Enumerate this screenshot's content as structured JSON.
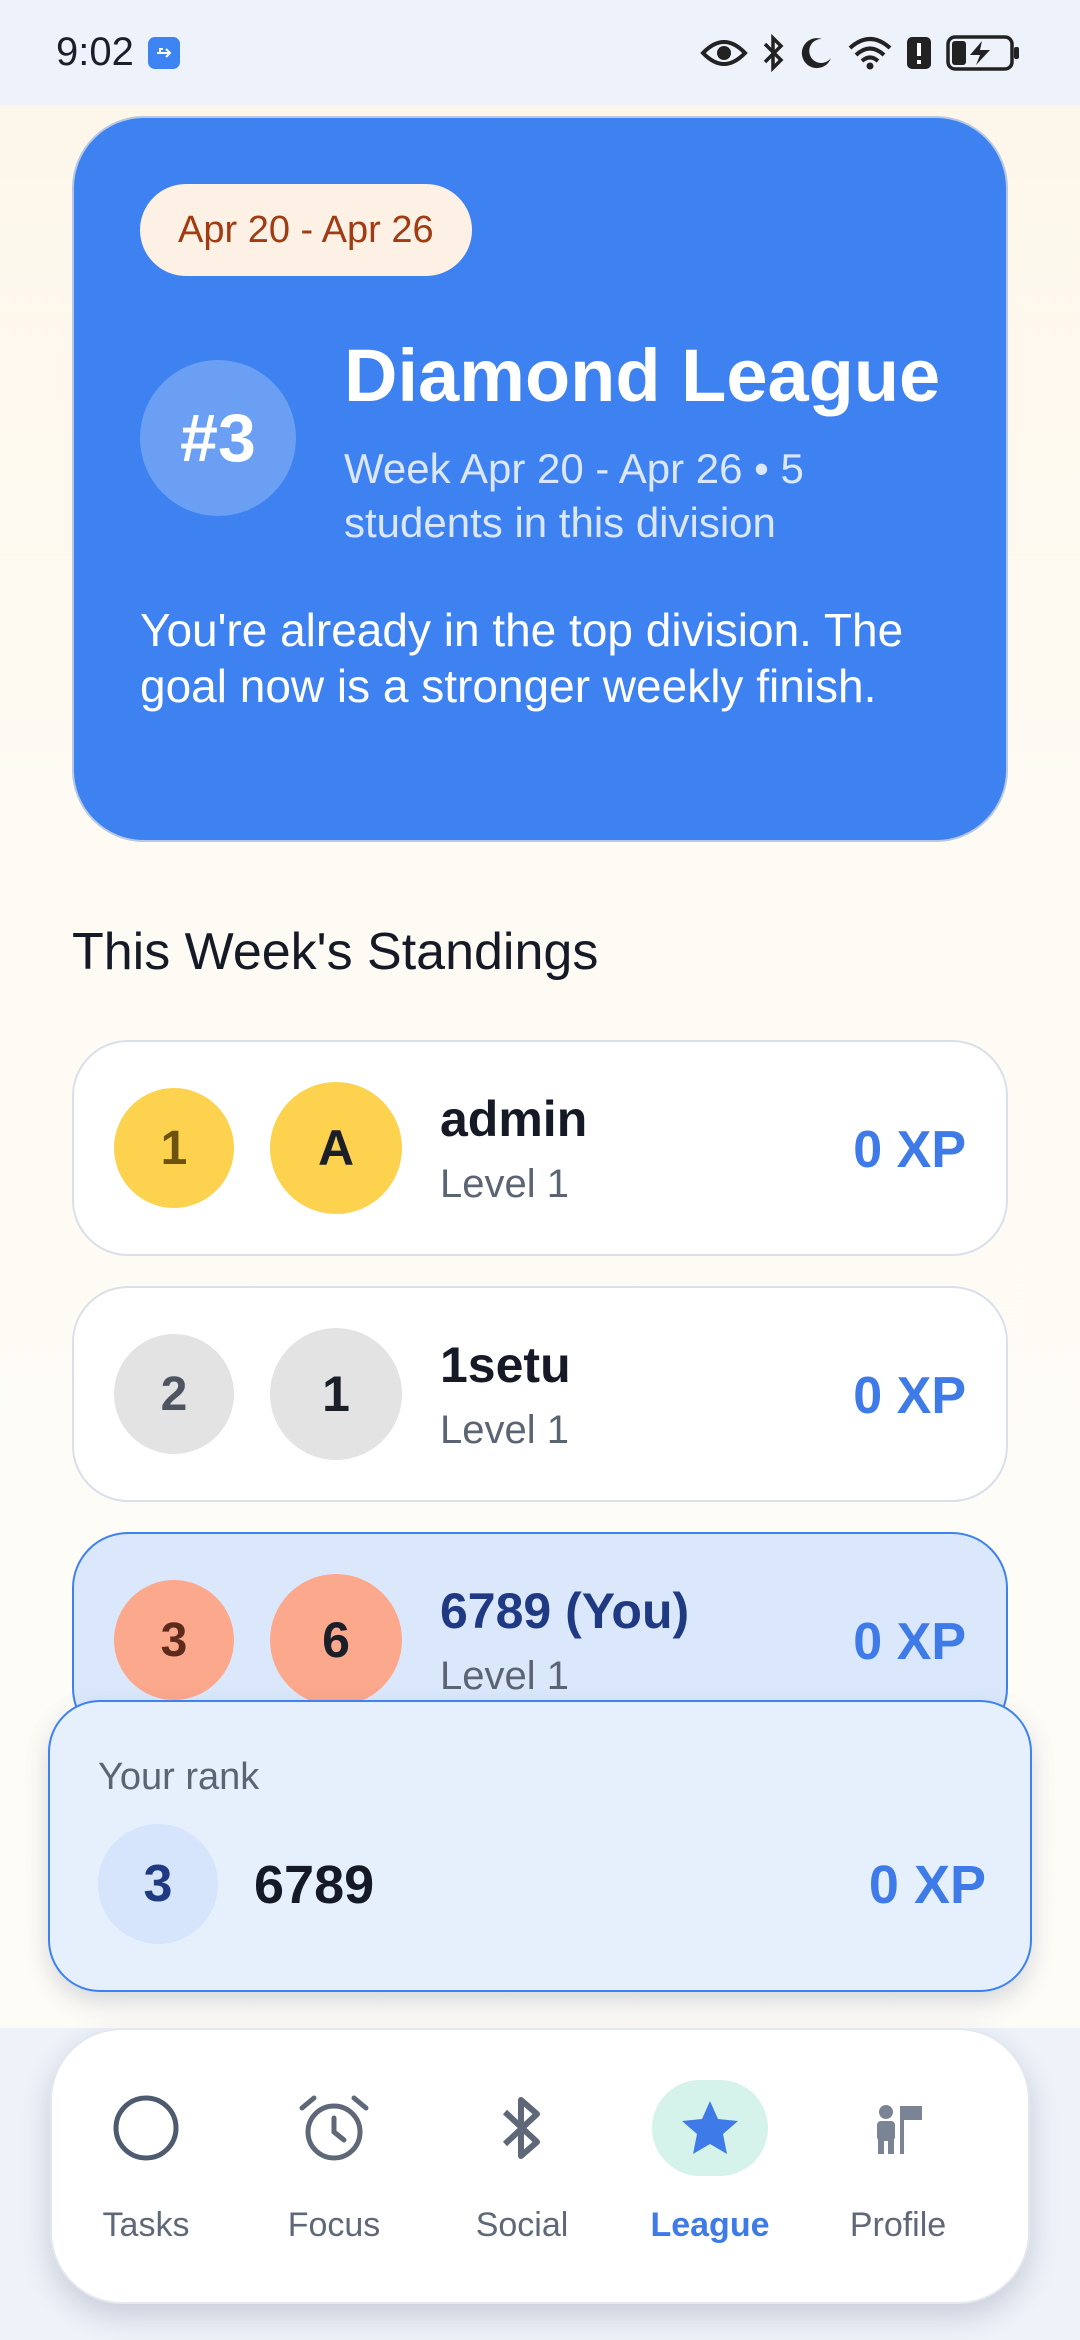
{
  "status_bar": {
    "time": "9:02",
    "icons": [
      "usb-icon",
      "eye-icon",
      "bluetooth-icon",
      "moon-icon",
      "wifi-icon",
      "alert-icon",
      "battery-charging-icon"
    ]
  },
  "hero": {
    "date_range": "Apr 20 - Apr 26",
    "rank": "#3",
    "league_name": "Diamond League",
    "subtitle": "Week Apr 20 - Apr 26  •  5 students in this division",
    "message": "You're already in the top division. The goal now is a stronger weekly finish.",
    "colors": {
      "card": "#3e82f1",
      "pill_bg": "#fdf1e6",
      "pill_text": "#a03b12"
    }
  },
  "standings": {
    "title": "This Week's Standings",
    "rows": [
      {
        "position": "1",
        "avatar_letter": "A",
        "name": "admin",
        "level": "Level 1",
        "xp": "0 XP",
        "color": "#fdd24e",
        "highlight": false
      },
      {
        "position": "2",
        "avatar_letter": "1",
        "name": "1setu",
        "level": "Level 1",
        "xp": "0 XP",
        "color": "#e3e3e3",
        "highlight": false
      },
      {
        "position": "3",
        "avatar_letter": "6",
        "name": "6789 (You)",
        "level": "Level 1",
        "xp": "0 XP",
        "color": "#fca88c",
        "highlight": true
      }
    ]
  },
  "your_rank": {
    "label": "Your rank",
    "position": "3",
    "name": "6789",
    "xp": "0 XP"
  },
  "nav": {
    "items": [
      {
        "label": "Tasks",
        "icon": "circle-icon",
        "active": false
      },
      {
        "label": "Focus",
        "icon": "alarm-clock-icon",
        "active": false
      },
      {
        "label": "Social",
        "icon": "bluetooth-icon",
        "active": false
      },
      {
        "label": "League",
        "icon": "star-icon",
        "active": true
      },
      {
        "label": "Profile",
        "icon": "person-flag-icon",
        "active": false
      }
    ]
  }
}
